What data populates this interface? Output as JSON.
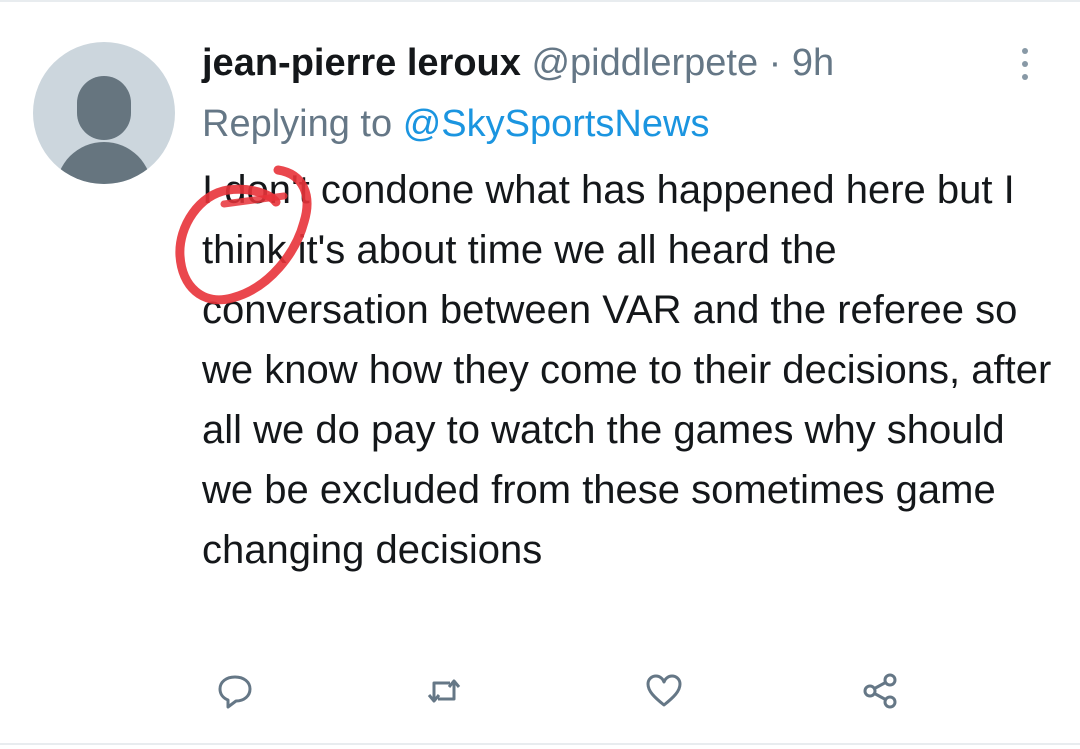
{
  "tweet": {
    "display_name": "jean-pierre leroux",
    "handle": "@piddlerpete",
    "separator": "·",
    "time": "9h",
    "reply_prefix": "Replying to",
    "reply_target": "@SkySportsNews",
    "text": "I don't condone what has happened here but I think it's about time we all heard the conversation between VAR and the referee so we know how they come to their decisions, after all we do pay to watch the games why should we be excluded from these sometimes game changing decisions"
  },
  "actions": [
    {
      "icon": "reply-icon"
    },
    {
      "icon": "retweet-icon"
    },
    {
      "icon": "like-icon"
    },
    {
      "icon": "share-icon"
    }
  ],
  "colors": {
    "text": "#14171a",
    "secondary": "#657786",
    "link": "#1b95e0",
    "avatar_bg": "#ccd6dd",
    "annotation": "#e8333a"
  }
}
